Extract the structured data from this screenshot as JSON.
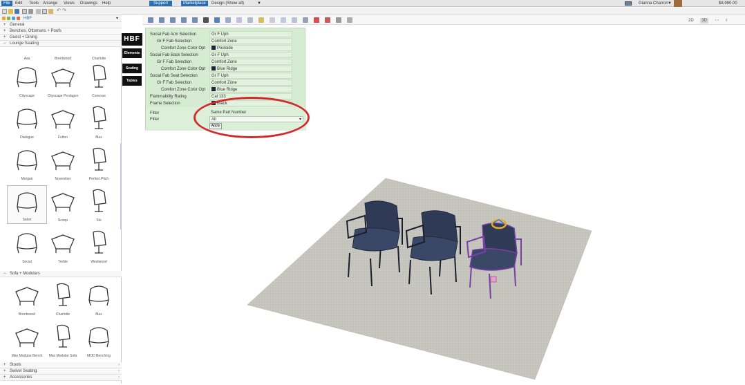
{
  "menubar": {
    "items": [
      "File",
      "Edit",
      "Tools",
      "Arrange",
      "Views",
      "Drawings",
      "Help"
    ],
    "support": "Support",
    "marketplace": "Marketplace",
    "design": "Design (Show all)",
    "design_arrow": "▼",
    "user": "Gianna Charron",
    "user_arrow": "▼",
    "price": "$8,990.00"
  },
  "library": {
    "path": "HBF",
    "categories_top": [
      "General",
      "Benches, Ottomans + Poufs",
      "Guest + Dining",
      "Lounge Seating"
    ],
    "lounge_first_row": [
      "Asa",
      "Brentwood",
      "Charlotte"
    ],
    "lounge_items": [
      "Cityscape",
      "Cityscape Pentagon",
      "Conexus",
      "Dialogue",
      "Fulton",
      "Max",
      "Morgan",
      "November",
      "Perfect Pitch",
      "Salon",
      "Scoop",
      "Slo",
      "Social",
      "Treble",
      "Westwood"
    ],
    "sofa_category": "Sofa + Modulars",
    "sofa_items": [
      "Brentwood",
      "Charlotte",
      "Max",
      "Max Modular Bench",
      "Max Modular Sofa",
      "MOD Benching"
    ],
    "categories_bottom": [
      "Stools",
      "Swivel Seating",
      "Accessories"
    ],
    "selected": "Salon"
  },
  "brand_column": {
    "logo": "HBF",
    "tiles": [
      "Elements",
      "Seating",
      "Tables"
    ]
  },
  "view_controls": [
    "2D",
    "3D",
    "⋯",
    "r"
  ],
  "properties": {
    "rows": [
      {
        "key": "Social Fab Arm Selection",
        "value": "Gr F Uph",
        "indent": 0
      },
      {
        "key": "Gr F Fab Selection",
        "value": "Comfort Zone",
        "indent": 1
      },
      {
        "key": "Comfort Zone Color Opt",
        "value": "Poolside",
        "indent": 2,
        "swatch": true
      },
      {
        "key": "Social Fab Back Selection",
        "value": "Gr F Uph",
        "indent": 0
      },
      {
        "key": "Gr F Fab Selection",
        "value": "Comfort Zone",
        "indent": 1
      },
      {
        "key": "Comfort Zone Color Opt",
        "value": "Blue Ridge",
        "indent": 2,
        "swatch": true
      },
      {
        "key": "Social Fab Seat Selection",
        "value": "Gr F Uph",
        "indent": 0
      },
      {
        "key": "Gr F Fab Selection",
        "value": "Comfort Zone",
        "indent": 1
      },
      {
        "key": "Comfort Zone Color Opt",
        "value": "Blue Ridge",
        "indent": 2,
        "swatch": true
      },
      {
        "key": "Flammability Rating",
        "value": "Cal 133",
        "indent": 0
      },
      {
        "key": "Frame Selection",
        "value": "Black",
        "indent": 0,
        "swatch": true
      }
    ],
    "filter_label_1": "Filter",
    "filter_value_1": "Same Part Number",
    "filter_label_2": "Filter",
    "filter_value_2": "All",
    "apply": "Apply"
  },
  "colors": {
    "menu_accent": "#2a6fb3",
    "panel_green": "#d6ecd2",
    "annotation_red": "#d12b2b",
    "chair_navy": "#2f3b56",
    "floor_gray": "#c4c4bd"
  }
}
